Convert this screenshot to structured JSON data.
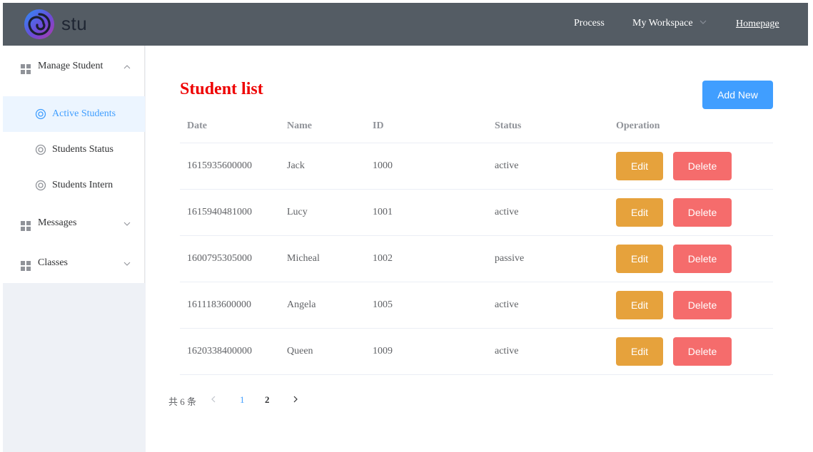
{
  "header": {
    "brand": "stu",
    "nav": {
      "process": "Process",
      "workspace": "My Workspace",
      "homepage": "Homepage"
    }
  },
  "sidebar": {
    "groups": [
      {
        "label": "Manage Student",
        "expanded": true,
        "items": [
          {
            "label": "Active Students",
            "active": true
          },
          {
            "label": "Students Status",
            "active": false
          },
          {
            "label": "Students Intern",
            "active": false
          }
        ]
      },
      {
        "label": "Messages",
        "expanded": false
      },
      {
        "label": "Classes",
        "expanded": false
      }
    ]
  },
  "main": {
    "title": "Student list",
    "add_button": "Add New",
    "table": {
      "columns": [
        "Date",
        "Name",
        "ID",
        "Status",
        "Operation"
      ],
      "rows": [
        {
          "date": "1615935600000",
          "name": "Jack",
          "id": "1000",
          "status": "active"
        },
        {
          "date": "1615940481000",
          "name": "Lucy",
          "id": "1001",
          "status": "active"
        },
        {
          "date": "1600795305000",
          "name": "Micheal",
          "id": "1002",
          "status": "passive"
        },
        {
          "date": "1611183600000",
          "name": "Angela",
          "id": "1005",
          "status": "active"
        },
        {
          "date": "1620338400000",
          "name": "Queen",
          "id": "1009",
          "status": "active"
        }
      ],
      "edit_label": "Edit",
      "delete_label": "Delete"
    },
    "pagination": {
      "total": "共 6 条",
      "pages": [
        "1",
        "2"
      ],
      "current": "1"
    }
  },
  "colors": {
    "header_bg": "#545c64",
    "primary": "#409eff",
    "warning": "#e6a23c",
    "danger": "#f56c6c",
    "title": "#ee0000"
  },
  "icons": {
    "logo": "swirl-logo-icon",
    "menu_group": "grid-icon",
    "submenu": "ring-icon",
    "expand": "chevron-down-icon",
    "collapse": "chevron-up-icon",
    "prev": "chevron-left-icon",
    "next": "chevron-right-icon"
  }
}
